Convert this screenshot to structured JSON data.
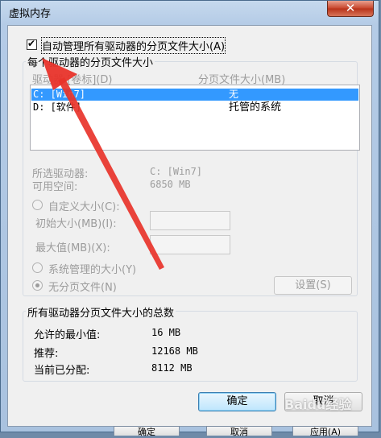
{
  "window": {
    "title": "虚拟内存",
    "close_glyph": "✕"
  },
  "auto_manage": {
    "label": "自动管理所有驱动器的分页文件大小(A)",
    "checked": true
  },
  "per_drive": {
    "group_title": "每个驱动器的分页文件大小",
    "col_drive": "驱动器 [卷标](D)",
    "col_size": "分页文件大小(MB)",
    "rows": [
      {
        "drive": "C:   [Win7]",
        "size": "无",
        "selected": true
      },
      {
        "drive": "D:   [软件]",
        "size": "托管的系统",
        "selected": false
      }
    ],
    "selected_drive_label": "所选驱动器:",
    "selected_drive_value": "C:  [Win7]",
    "free_space_label": "可用空间:",
    "free_space_value": "6850 MB",
    "custom_size_label": "自定义大小(C):",
    "initial_size_label": "初始大小(MB)(I):",
    "initial_size_value": "",
    "max_size_label": "最大值(MB)(X):",
    "max_size_value": "",
    "system_managed_label": "系统管理的大小(Y)",
    "no_paging_label": "无分页文件(N)",
    "set_button": "设置(S)"
  },
  "totals": {
    "group_title": "所有驱动器分页文件大小的总数",
    "min_label": "允许的最小值:",
    "min_value": "16 MB",
    "recommended_label": "推荐:",
    "recommended_value": "12168 MB",
    "allocated_label": "当前已分配:",
    "allocated_value": "8112 MB"
  },
  "buttons": {
    "ok": "确定",
    "cancel": "取消"
  },
  "background_buttons": {
    "ok": "确定",
    "cancel": "取消",
    "apply": "应用(A)"
  },
  "watermark": "Baidu经验",
  "colors": {
    "selection": "#3399ff",
    "arrow": "#e8332a",
    "disabled_text": "#9c9c9c"
  }
}
